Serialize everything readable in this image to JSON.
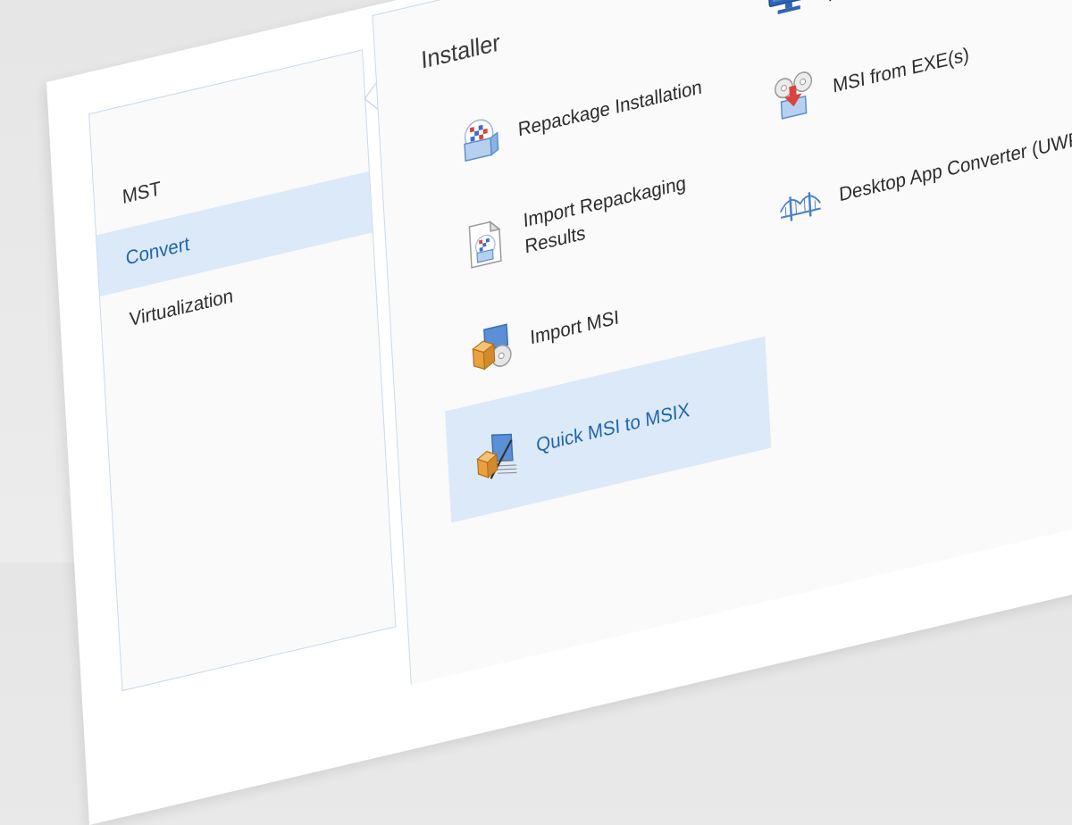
{
  "nav": {
    "items": [
      {
        "label": "MST",
        "selected": false
      },
      {
        "label": "Convert",
        "selected": true
      },
      {
        "label": "Virtualization",
        "selected": false
      }
    ]
  },
  "main": {
    "section_title": "Installer",
    "tiles": [
      {
        "label": "Repackage Installation",
        "icon": "repackage-installation-icon"
      },
      {
        "label": "Import Repackaging Results",
        "icon": "import-repackaging-results-icon"
      },
      {
        "label": "Import MSI",
        "icon": "import-msi-icon"
      },
      {
        "label": "Quick MSI to MSIX",
        "icon": "quick-msi-to-msix-icon",
        "selected": true
      },
      {
        "label": "Repackager Session Monitoring",
        "icon": "repackager-session-monitoring-icon"
      },
      {
        "label": "MSI from EXE(s)",
        "icon": "msi-from-exe-icon"
      },
      {
        "label": "Desktop App Converter (UWP)",
        "icon": "desktop-app-converter-icon"
      }
    ]
  },
  "colors": {
    "accent": "#1f66ad",
    "selection_bg": "#dce9f8",
    "border": "#c9d9ee",
    "box_orange": "#e8a142",
    "box_blue": "#8ab3e0"
  }
}
